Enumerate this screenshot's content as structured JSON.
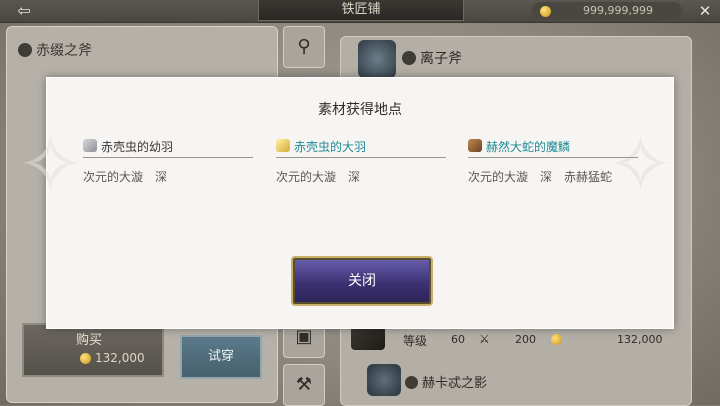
{
  "topbar": {
    "back_glyph": "⇦",
    "title": "铁匠铺",
    "gold_amount": "999,999,999",
    "close_glyph": "✕"
  },
  "left": {
    "weapon_name": "赤缀之斧",
    "buy_label": "购买",
    "buy_price": "132,000",
    "try_label": "试穿"
  },
  "right": {
    "top_item_name": "离子斧",
    "row": {
      "level_label": "等级",
      "level_value": "60",
      "attack_value": "200",
      "price": "132,000"
    },
    "bottom_item_name": "赫卡忒之影"
  },
  "modal": {
    "title": "素材获得地点",
    "materials": [
      {
        "name": "赤壳虫的幼羽",
        "color": "#3a3835",
        "icon": "feather-icon",
        "sources": [
          "次元的大漩",
          "深"
        ]
      },
      {
        "name": "赤壳虫的大羽",
        "color": "#1e8a94",
        "icon": "golden-feather-icon",
        "sources": [
          "次元的大漩",
          "深"
        ]
      },
      {
        "name": "赫然大蛇的魔鳞",
        "color": "#1e8a94",
        "icon": "scale-icon",
        "sources": [
          "次元的大漩",
          "深",
          "赤赫猛蛇"
        ]
      }
    ],
    "close_label": "关闭"
  }
}
